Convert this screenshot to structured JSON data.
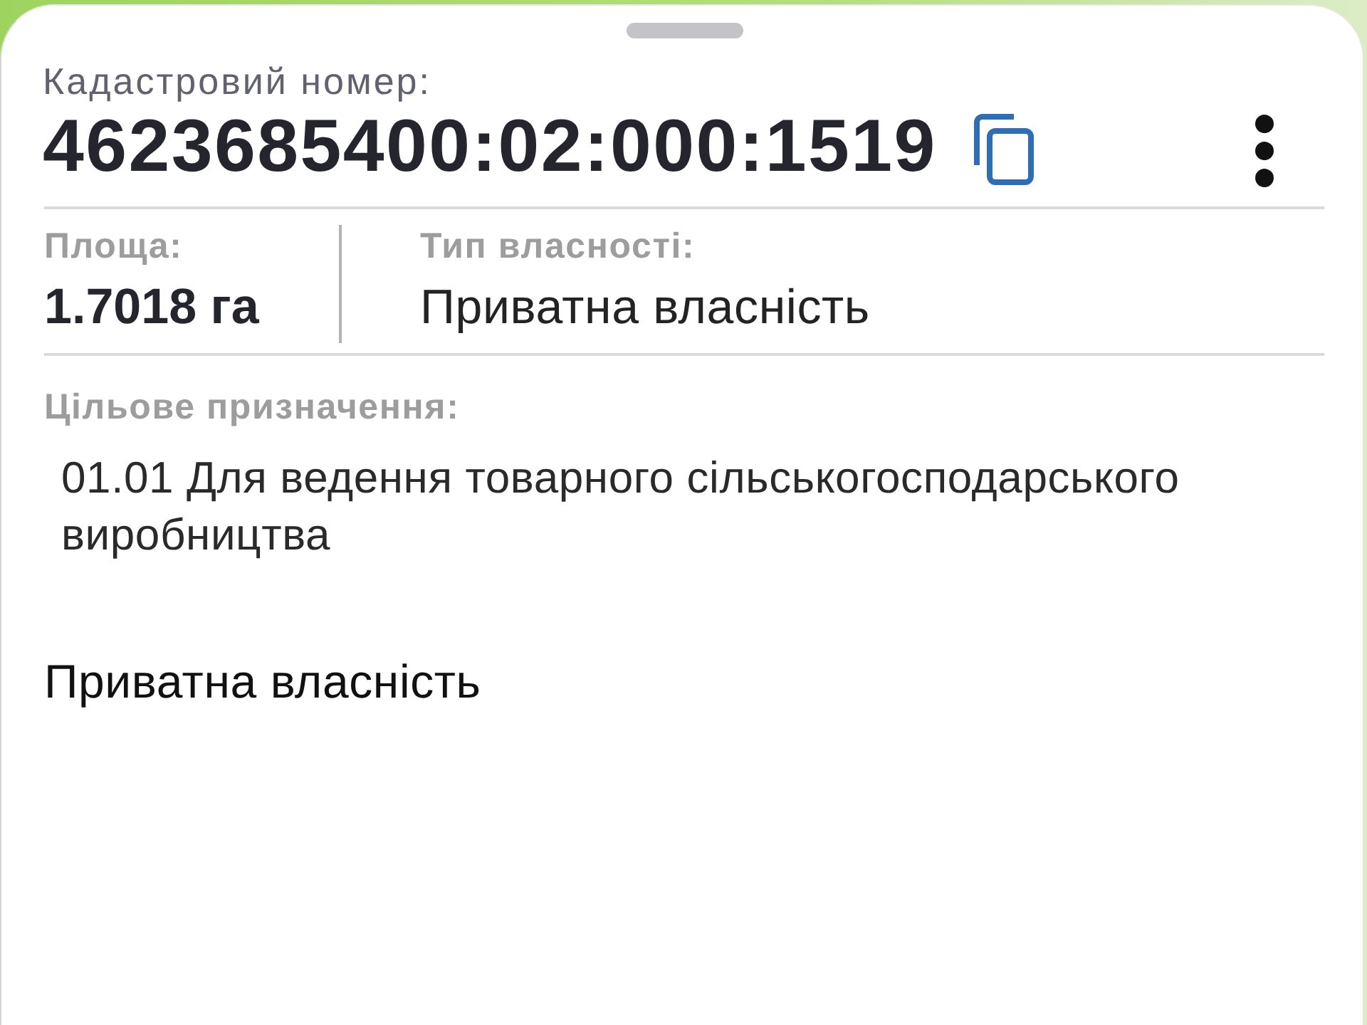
{
  "cadastral": {
    "label": "Кадастровий номер:",
    "number": "4623685400:02:000:1519"
  },
  "details": [
    {
      "kind": "measure",
      "label": "Площа:",
      "value": "1.7018 га"
    },
    {
      "kind": "text",
      "label": "Тип власності:",
      "value": "Приватна власність"
    }
  ],
  "purpose": {
    "label": "Цільове призначення:",
    "value": "01.01 Для ведення товарного сільськогосподарського виробництва"
  },
  "footer_text": "Приватна власність"
}
